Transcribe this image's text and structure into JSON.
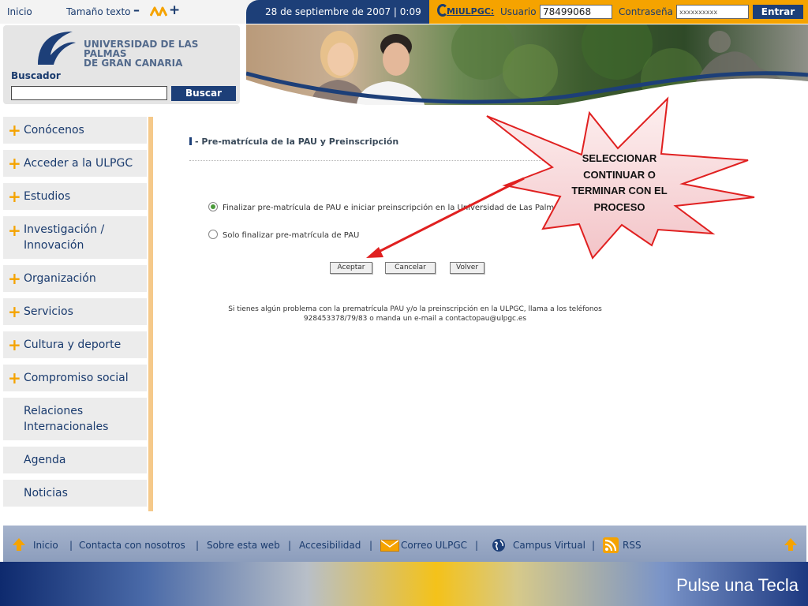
{
  "topbar": {
    "inicio": "Inicio",
    "tamano_texto": "Tamaño texto",
    "minus": "–",
    "plus": "+",
    "date": "28 de septiembre de 2007 | 0:09",
    "miulpgc": "MiULPGC:",
    "usuario_label": "Usuario",
    "usuario_value": "78499068",
    "password_label": "Contraseña",
    "password_value": "xxxxxxxxxx",
    "entrar": "Entrar"
  },
  "header": {
    "university_line1": "UNIVERSIDAD DE LAS PALMAS",
    "university_line2": "DE GRAN CANARIA",
    "search_label": "Buscador",
    "search_button": "Buscar"
  },
  "sidebar": {
    "items": [
      {
        "label": "Conócenos",
        "plus": "+"
      },
      {
        "label": "Acceder a la ULPGC",
        "plus": "+"
      },
      {
        "label": "Estudios",
        "plus": "+"
      },
      {
        "label": "Investigación / Innovación",
        "plus": "+"
      },
      {
        "label": "Organización",
        "plus": "+"
      },
      {
        "label": "Servicios",
        "plus": "+"
      },
      {
        "label": "Cultura y deporte",
        "plus": "+"
      },
      {
        "label": "Compromiso social",
        "plus": "+"
      },
      {
        "label": "Relaciones Internacionales"
      },
      {
        "label": "Agenda"
      },
      {
        "label": "Noticias"
      }
    ]
  },
  "main": {
    "title": "- Pre-matrícula de la PAU y Preinscripción",
    "options": [
      {
        "label": "Finalizar pre-matrícula de PAU e iniciar preinscripción en la Universidad de Las Palmas de G",
        "selected": true
      },
      {
        "label": "Solo finalizar pre-matrícula de PAU",
        "selected": false
      }
    ],
    "buttons": {
      "accept": "Aceptar",
      "cancel": "Cancelar",
      "back": "Volver"
    },
    "help_line1": "Si tienes algún problema con la prematrícula PAU y/o la preinscripción en la ULPGC, llama a los teléfonos",
    "help_line2": "928453378/79/83 o manda un e-mail a contactopau@ulpgc.es"
  },
  "callout": {
    "text": "SELECCIONAR CONTINUAR O TERMINAR CON EL PROCESO",
    "fill": "#f8d4d6",
    "stroke": "#e02020"
  },
  "footer": {
    "inicio": "Inicio",
    "contacta": "Contacta con nosotros",
    "sobre": "Sobre esta web",
    "accesibilidad": "Accesibilidad",
    "correo": "Correo ULPGC",
    "campus": "Campus Virtual",
    "rss": "RSS",
    "separator": "|"
  },
  "slide": {
    "hint": "Pulse una Tecla"
  },
  "colors": {
    "navy": "#1d3f78",
    "orange": "#f5a300",
    "sidebar_bg": "#ececec"
  }
}
